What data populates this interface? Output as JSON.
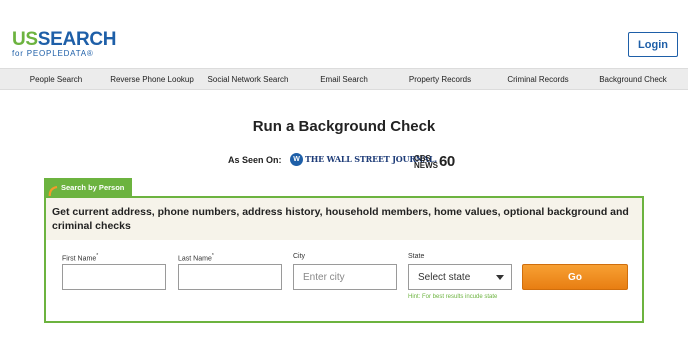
{
  "header": {
    "logo_us": "US",
    "logo_search": "SEARCH",
    "logo_tagline": "for PEOPLEDATA®",
    "login_label": "Login"
  },
  "nav": {
    "items": [
      {
        "label": "People Search"
      },
      {
        "label": "Reverse Phone Lookup"
      },
      {
        "label": "Social Network Search"
      },
      {
        "label": "Email Search"
      },
      {
        "label": "Property Records"
      },
      {
        "label": "Criminal Records"
      },
      {
        "label": "Background Check"
      }
    ]
  },
  "main": {
    "title": "Run a Background Check",
    "as_seen_on": "As Seen On:",
    "press": {
      "wsj": "THE WALL STREET JOURNAL.",
      "cbs": "CBS NEWS",
      "sixty": "60"
    }
  },
  "search": {
    "tab_label": "Search by Person",
    "description": "Get current address, phone numbers, address history, household members, home values, optional background and criminal checks",
    "first_name_label": "First Name",
    "last_name_label": "Last Name",
    "city_label": "City",
    "city_placeholder": "Enter city",
    "state_label": "State",
    "state_value": "Select state",
    "state_hint": "Hint: For best results incude state",
    "go_label": "Go",
    "required_marker": "*"
  },
  "colors": {
    "brand_green": "#6cb33f",
    "brand_blue": "#1e5fa8",
    "go_orange": "#f39a2a"
  }
}
